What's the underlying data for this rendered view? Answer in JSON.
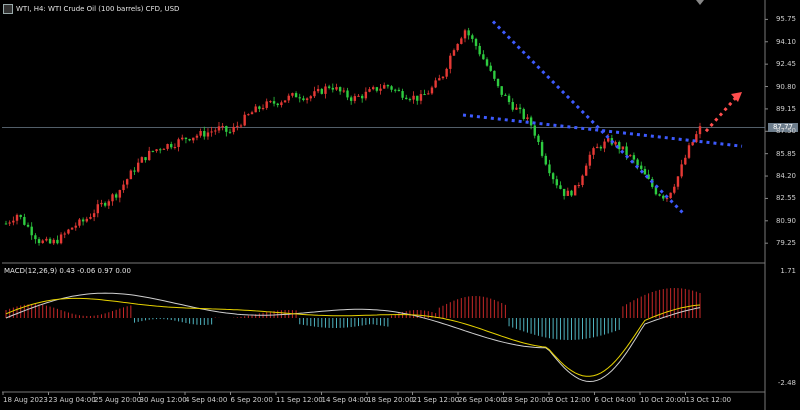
{
  "header": {
    "title": "WTI, H4:  WTI Crude Oil (100 barrels) CFD, USD"
  },
  "price_axis": {
    "labels": [
      "95.75",
      "94.10",
      "92.45",
      "90.80",
      "89.15",
      "87.50",
      "85.85",
      "84.20",
      "82.55",
      "80.90",
      "79.25"
    ],
    "current_price": "87.77"
  },
  "macd": {
    "title": "MACD(12,26,9) 0.43 -0.06 0.97 0.00",
    "axis_labels": [
      "1.71",
      "-2.48"
    ]
  },
  "time_axis": {
    "labels": [
      "18 Aug 2023",
      "23 Aug 04:00",
      "25 Aug 20:00",
      "30 Aug 12:00",
      "4 Sep 04:00",
      "6 Sep 20:00",
      "11 Sep 12:00",
      "14 Sep 04:00",
      "18 Sep 20:00",
      "21 Sep 12:00",
      "26 Sep 04:00",
      "28 Sep 20:00",
      "3 Oct 12:00",
      "6 Oct 04:00",
      "10 Oct 20:00",
      "13 Oct 12:00"
    ]
  },
  "colors": {
    "bull": "#e53935",
    "bear": "#2ecc40",
    "trendline": "#3d5afe",
    "projection": "#ff4d4d",
    "macd_signal": "#e6d200",
    "macd_line": "#cfcfcf",
    "hist_pos": "#c62828",
    "hist_neg": "#4fb3bf",
    "grid": "#444"
  },
  "chart_data": {
    "type": "candlestick",
    "symbol": "WTI",
    "timeframe": "H4",
    "ylim": [
      78.6,
      96.0
    ],
    "close_path": [
      80.7,
      81.4,
      80.4,
      79.4,
      79.2,
      79.7,
      80.5,
      80.9,
      81.7,
      82.4,
      83.0,
      84.2,
      85.3,
      86.0,
      86.4,
      86.6,
      87.0,
      87.2,
      87.4,
      87.7,
      87.4,
      88.2,
      88.9,
      89.4,
      89.6,
      89.9,
      90.2,
      90.0,
      90.4,
      90.9,
      90.3,
      89.9,
      90.2,
      90.6,
      90.9,
      90.4,
      90.1,
      89.9,
      90.6,
      91.6,
      93.7,
      95.0,
      93.8,
      92.3,
      90.6,
      89.6,
      88.8,
      87.9,
      85.7,
      83.9,
      82.8,
      83.3,
      85.6,
      86.4,
      86.8,
      86.2,
      85.4,
      84.3,
      83.1,
      82.6,
      84.1,
      86.2,
      87.7
    ],
    "annotations": [
      {
        "type": "descending_trendline",
        "from": [
          "26 Sep 04:00",
          95.6
        ],
        "to": [
          "10 Oct 20:00",
          81.4
        ]
      },
      {
        "type": "support_trendline",
        "from": [
          "26 Sep 04:00",
          88.7
        ],
        "to": [
          "13 Oct 12:00",
          86.4
        ]
      },
      {
        "type": "projection_arrow",
        "from": [
          "13 Oct 12:00",
          87.5
        ],
        "to_price": 90.4
      }
    ]
  }
}
